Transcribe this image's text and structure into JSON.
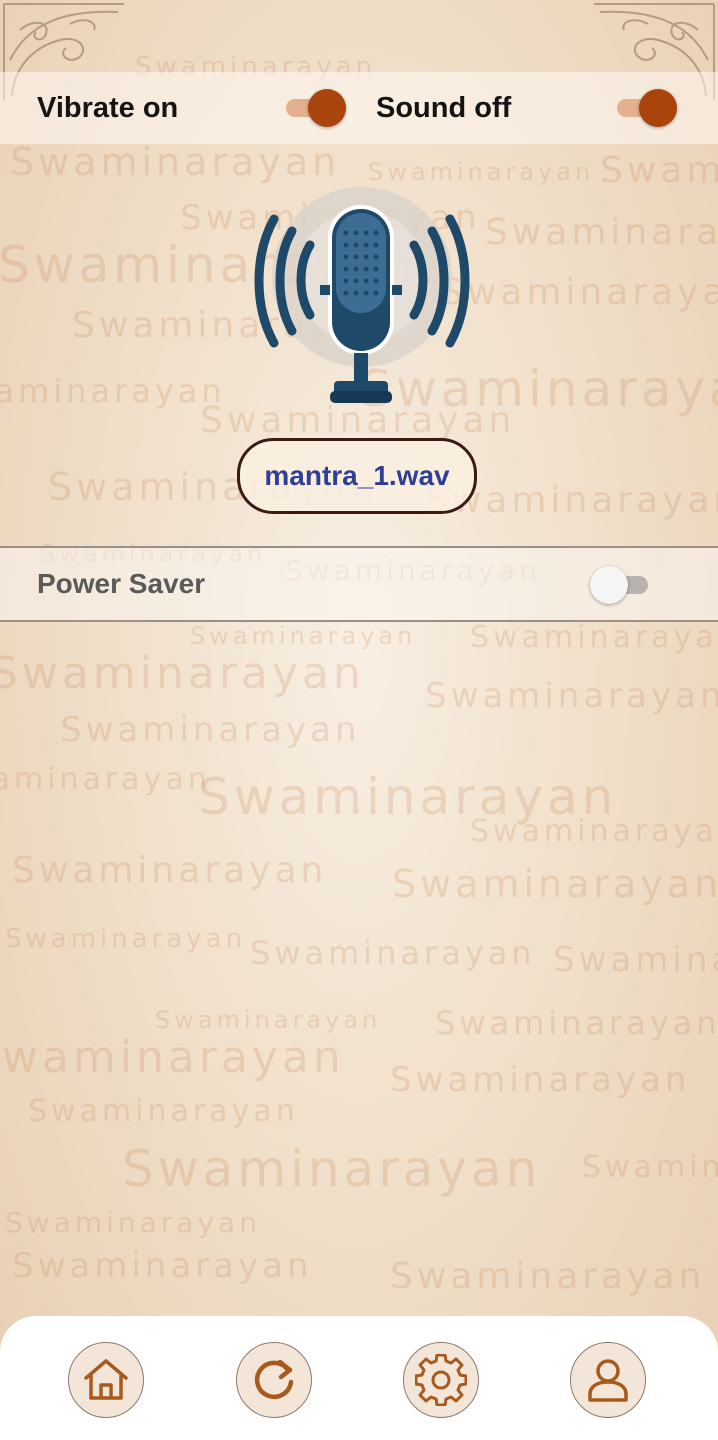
{
  "toggles": {
    "vibrate_label": "Vibrate on",
    "vibrate_on": true,
    "sound_label": "Sound off",
    "sound_on": true
  },
  "player": {
    "file_name": "mantra_1.wav"
  },
  "power_saver": {
    "label": "Power Saver",
    "enabled": false
  },
  "watermark_text": "Swaminarayan",
  "bottom_nav": {
    "items": [
      "home-icon",
      "refresh-icon",
      "settings-gear-icon",
      "profile-user-icon"
    ]
  },
  "colors": {
    "accent_thumb": "#a9450c",
    "accent_track": "#e5b08d",
    "file_text": "#2f3f92",
    "icon_brown": "#a85a1c",
    "mic_blue": "#1f4968"
  }
}
